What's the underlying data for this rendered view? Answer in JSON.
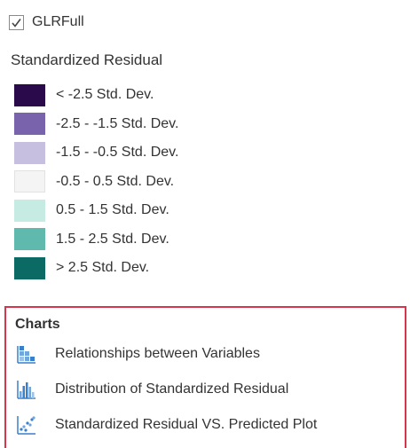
{
  "layer": {
    "name": "GLRFull",
    "checked": true
  },
  "legend": {
    "title": "Standardized Residual",
    "items": [
      {
        "label": "< -2.5 Std. Dev.",
        "color": "#2a0a4a"
      },
      {
        "label": "-2.5 - -1.5 Std. Dev.",
        "color": "#7a63ad"
      },
      {
        "label": "-1.5 - -0.5 Std. Dev.",
        "color": "#c7bfe0"
      },
      {
        "label": "-0.5 - 0.5 Std. Dev.",
        "color": "#f4f4f4"
      },
      {
        "label": "0.5 - 1.5 Std. Dev.",
        "color": "#c6ebe3"
      },
      {
        "label": "1.5 - 2.5 Std. Dev.",
        "color": "#5fb9ad"
      },
      {
        "label": "> 2.5 Std. Dev.",
        "color": "#0b6b64"
      }
    ]
  },
  "charts": {
    "title": "Charts",
    "border_color": "#d8344a",
    "items": [
      {
        "label": "Relationships between Variables",
        "icon": "scatter-matrix-icon"
      },
      {
        "label": "Distribution of Standardized Residual",
        "icon": "histogram-icon"
      },
      {
        "label": "Standardized Residual VS. Predicted Plot",
        "icon": "scatter-plot-icon"
      }
    ]
  },
  "colors": {
    "icon_blue": "#3a7fc9",
    "text": "#333333"
  }
}
